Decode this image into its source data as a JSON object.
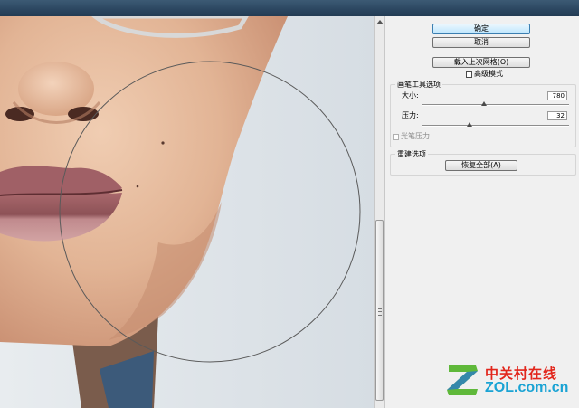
{
  "buttons": {
    "ok": "确定",
    "cancel": "取消",
    "load_last_mesh": "载入上次网格(O)",
    "restore_all": "恢复全部(A)"
  },
  "advanced_mode": {
    "label": "高级模式",
    "checked": false
  },
  "brush_options": {
    "title": "画笔工具选项",
    "size_label": "大小:",
    "size_value": "780",
    "size_slider_fraction": 0.42,
    "pressure_label": "压力:",
    "pressure_value": "32",
    "pressure_slider_fraction": 0.32,
    "stylus_pressure_label": "光笔压力",
    "stylus_pressure_checked": false
  },
  "reconstruct_options": {
    "title": "重建选项"
  },
  "watermark": {
    "cn": "中关村在线",
    "en": "ZOL.com.cn"
  },
  "colors": {
    "skin": "#e4b89a",
    "lips": "#b87a7c",
    "background_wall": "#dfe4e9",
    "brush_circle": "#5a5a5a",
    "zol_red": "#e2261c",
    "zol_blue": "#1aa3d4",
    "zol_green": "#5fb83a"
  }
}
